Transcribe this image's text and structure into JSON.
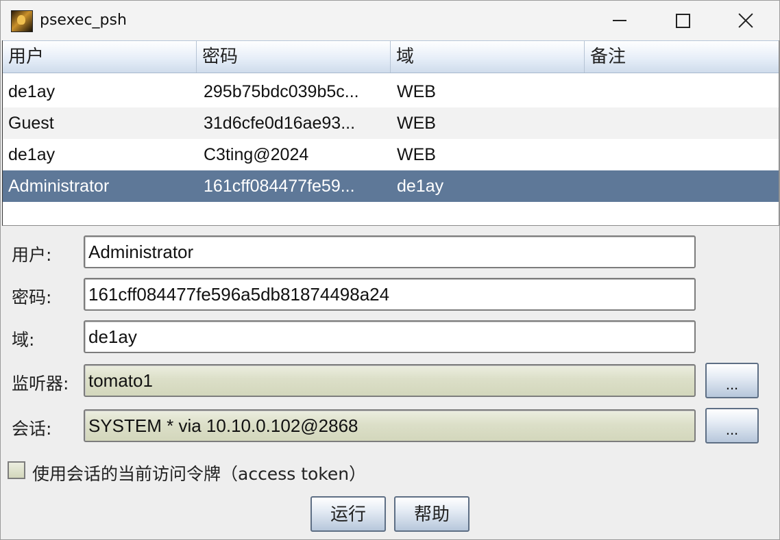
{
  "window": {
    "title": "psexec_psh",
    "icon": "app-avatar-icon"
  },
  "table": {
    "columns": [
      "用户",
      "密码",
      "域",
      "备注"
    ],
    "rows": [
      {
        "user": "de1ay",
        "password": "295b75bdc039b5c...",
        "domain": "WEB",
        "note": ""
      },
      {
        "user": "Guest",
        "password": "31d6cfe0d16ae93...",
        "domain": "WEB",
        "note": ""
      },
      {
        "user": "de1ay",
        "password": "C3ting@2024",
        "domain": "WEB",
        "note": ""
      },
      {
        "user": "Administrator",
        "password": "161cff084477fe59...",
        "domain": "de1ay",
        "note": "",
        "selected": true
      }
    ]
  },
  "form": {
    "user_label": "用户:",
    "user_value": "Administrator",
    "password_label": "密码:",
    "password_value": "161cff084477fe596a5db81874498a24",
    "domain_label": "域:",
    "domain_value": "de1ay",
    "listener_label": "监听器:",
    "listener_value": "tomato1",
    "listener_button": "...",
    "session_label": "会话:",
    "session_value": "SYSTEM * via  10.10.0.102@2868",
    "session_button": "...",
    "token_checkbox_label": "使用会话的当前访问令牌（access token）",
    "token_checked": false
  },
  "buttons": {
    "run": "运行",
    "help": "帮助"
  },
  "colors": {
    "selected_row": "#5e7898",
    "readonly_field": "#dcdfc8"
  }
}
